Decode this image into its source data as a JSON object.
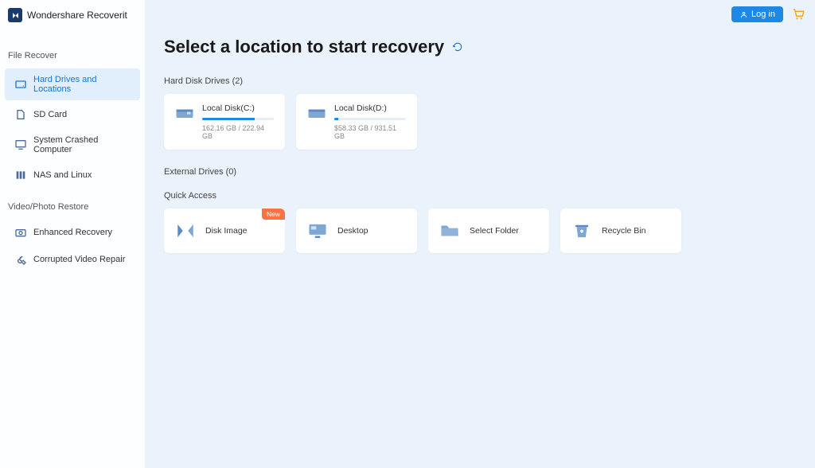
{
  "brand": "Wondershare Recoverit",
  "topbar": {
    "login": "Log in"
  },
  "sidebar": {
    "section1": "File Recover",
    "items1": [
      {
        "label": "Hard Drives and Locations"
      },
      {
        "label": "SD Card"
      },
      {
        "label": "System Crashed Computer"
      },
      {
        "label": "NAS and Linux"
      }
    ],
    "section2": "Video/Photo Restore",
    "items2": [
      {
        "label": "Enhanced Recovery"
      },
      {
        "label": "Corrupted Video Repair"
      }
    ]
  },
  "page": {
    "title": "Select a location to start recovery",
    "hdd_heading": "Hard Disk Drives (2)",
    "ext_heading": "External Drives (0)",
    "quick_heading": "Quick Access"
  },
  "drives": [
    {
      "name": "Local Disk(C:)",
      "used": "162.16 GB / 222.94 GB",
      "pct": 73
    },
    {
      "name": "Local Disk(D:)",
      "used": "$58.33 GB / 931.51 GB",
      "pct": 6
    }
  ],
  "quick": [
    {
      "label": "Disk Image",
      "badge": "New"
    },
    {
      "label": "Desktop"
    },
    {
      "label": "Select Folder"
    },
    {
      "label": "Recycle Bin"
    }
  ]
}
